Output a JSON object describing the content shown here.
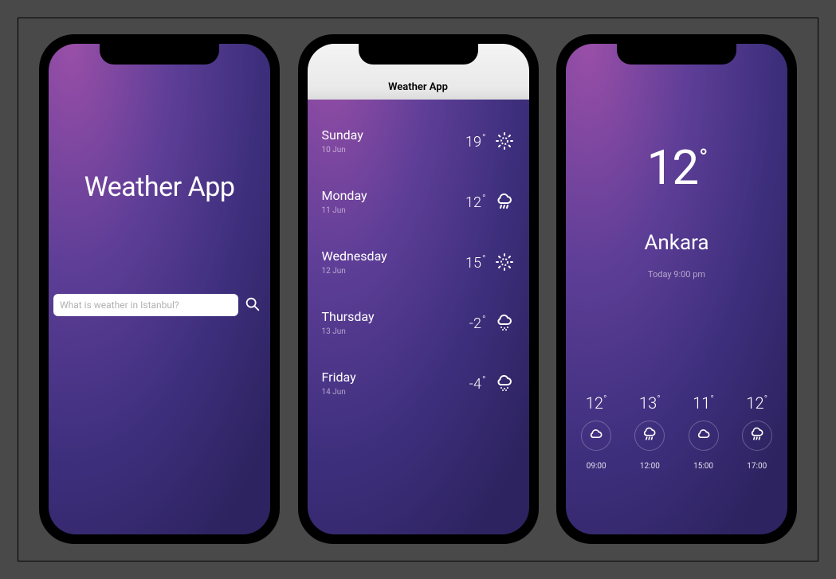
{
  "screen1": {
    "title": "Weather App",
    "search_placeholder": "What is weather in Istanbul?"
  },
  "screen2": {
    "nav_title": "Weather App",
    "days": [
      {
        "day": "Sunday",
        "date": "10 Jun",
        "temp": "19",
        "icon": "sunny"
      },
      {
        "day": "Monday",
        "date": "11 Jun",
        "temp": "12",
        "icon": "rain"
      },
      {
        "day": "Wednesday",
        "date": "12 Jun",
        "temp": "15",
        "icon": "sunny"
      },
      {
        "day": "Thursday",
        "date": "13 Jun",
        "temp": "-2",
        "icon": "snow"
      },
      {
        "day": "Friday",
        "date": "14 Jun",
        "temp": "-4",
        "icon": "snow"
      }
    ]
  },
  "screen3": {
    "big_temp": "12",
    "city": "Ankara",
    "subtitle": "Today 9:00 pm",
    "hourly": [
      {
        "temp": "12",
        "icon": "cloud",
        "time": "09:00"
      },
      {
        "temp": "13",
        "icon": "rain",
        "time": "12:00"
      },
      {
        "temp": "11",
        "icon": "cloud",
        "time": "15:00"
      },
      {
        "temp": "12",
        "icon": "rain",
        "time": "17:00"
      }
    ]
  }
}
